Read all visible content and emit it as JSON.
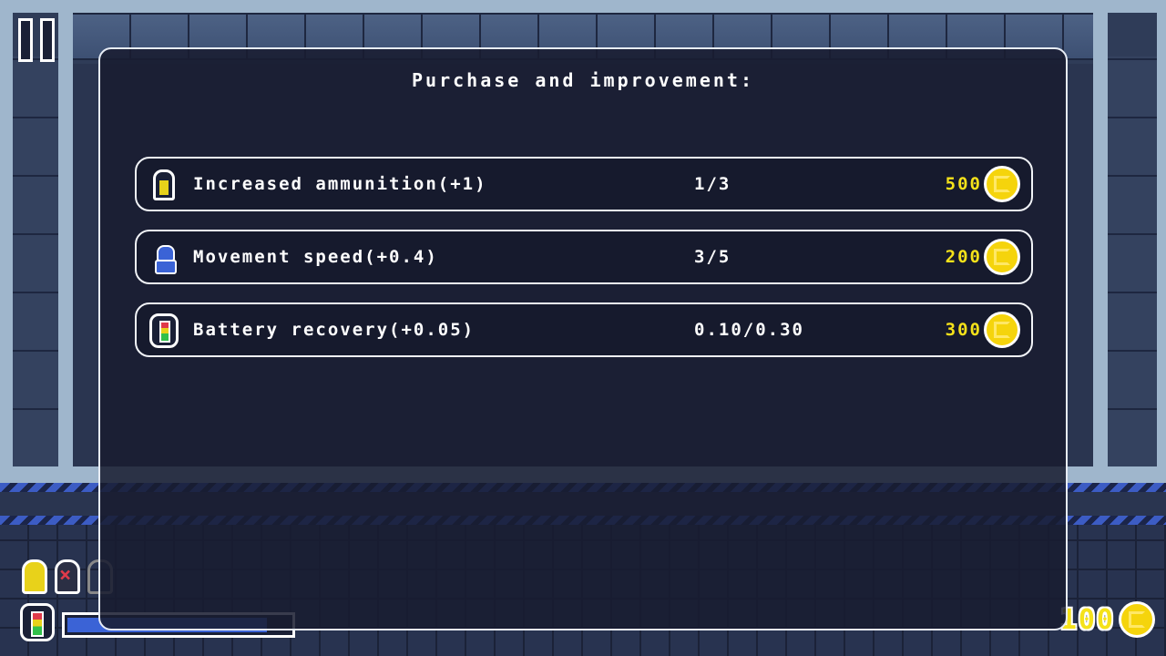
{
  "hud": {
    "pause_icon": "pause-icon",
    "ammo": {
      "loaded": 1,
      "empty": 1,
      "locked": 1
    },
    "battery_level": 0.9,
    "coins": "100",
    "coin_icon": "coin-icon"
  },
  "shop": {
    "title": "Purchase and improvement:",
    "items": [
      {
        "icon": "ammo-icon",
        "name": "Increased ammunition(+1)",
        "level": "1/3",
        "price": "500"
      },
      {
        "icon": "speed-icon",
        "name": "Movement speed(+0.4)",
        "level": "3/5",
        "price": "200"
      },
      {
        "icon": "battery-icon",
        "name": "Battery recovery(+0.05)",
        "level": "0.10/0.30",
        "price": "300"
      }
    ]
  },
  "colors": {
    "price": "#f5e21a",
    "coin": "#f5d40c",
    "panel_border": "#e7ecf5",
    "battery_fill": "#3b63d6",
    "ammo": "#e8d21a"
  }
}
